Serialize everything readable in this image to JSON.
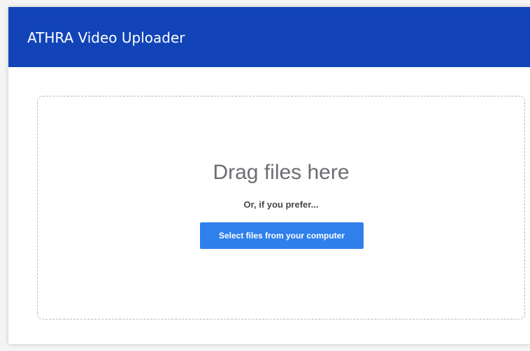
{
  "header": {
    "title": "ATHRA Video Uploader",
    "background_color": "#1244b8"
  },
  "dropzone": {
    "title": "Drag files here",
    "subtitle": "Or, if you prefer...",
    "select_button_label": "Select files from your computer",
    "button_color": "#2f80ed"
  }
}
